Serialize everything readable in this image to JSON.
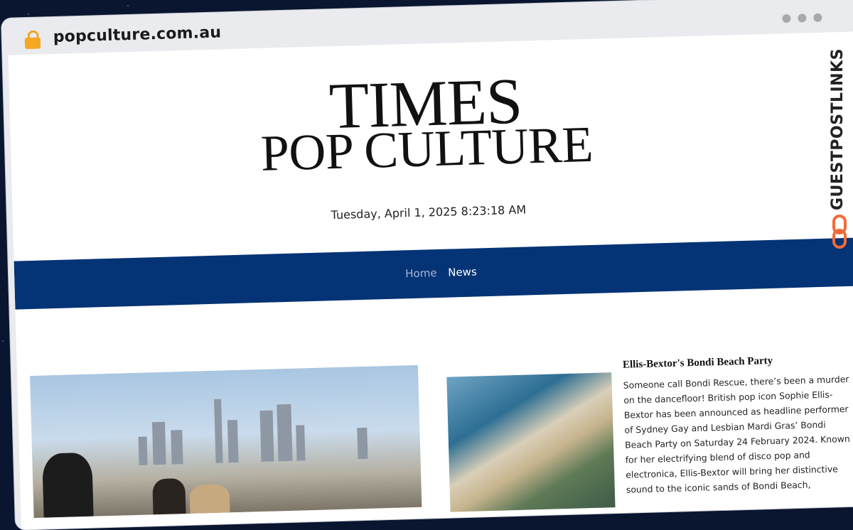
{
  "browser": {
    "url": "popculture.com.au",
    "lock_icon": "lock-icon"
  },
  "masthead": {
    "title_line1": "TIMES",
    "title_line2": "POP CULTURE",
    "datetime": "Tuesday, April 1, 2025 8:23:18 AM"
  },
  "nav": {
    "items": [
      {
        "label": "Home"
      },
      {
        "label": "News"
      }
    ]
  },
  "article": {
    "title": "Ellis-Bextor's Bondi Beach Party",
    "body": "Someone call Bondi Rescue, there’s been a murder on the dancefloor! British pop icon Sophie Ellis-Bextor has been announced as headline performer of Sydney Gay and Lesbian Mardi Gras’ Bondi Beach Party on Saturday 24 February 2024. Known for her electrifying blend of disco pop and electronica, Ellis-Bextor will bring her distinctive sound to the iconic sands of Bondi Beach,"
  },
  "branding": {
    "watermark": "GUESTPOSTLINKS",
    "accent_color": "#f26b3a"
  },
  "colors": {
    "nav_bg": "#043376",
    "lock": "#f5a623"
  }
}
